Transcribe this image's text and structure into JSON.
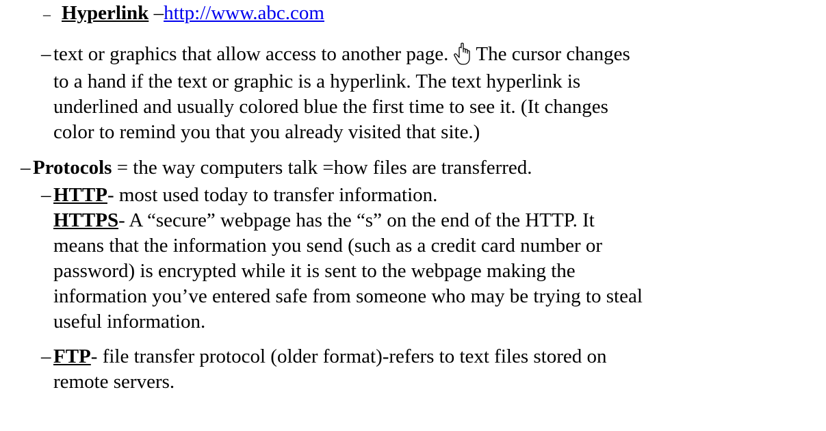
{
  "hyperlink": {
    "dash": "–",
    "term": "Hyperlink",
    "separator": " –",
    "url": "http://www.abc.com"
  },
  "hyperlink_desc": {
    "dash": "–",
    "line1a": "text or graphics that allow access to another page.",
    "cursor_icon": "hand-pointer-icon",
    "line1b": "The cursor changes",
    "line2": "to a hand if the text or graphic is a hyperlink. The text hyperlink is",
    "line3": "underlined and usually colored blue the first time to see it.  (It changes",
    "line4": "color to remind you that you already visited that site.)"
  },
  "protocols": {
    "dash": "–",
    "term": "Protocols",
    "text": " = the way computers talk =how files are transferred."
  },
  "http": {
    "dash": "–",
    "term": "HTTP",
    "text": "- most used today to transfer information."
  },
  "https": {
    "term": "HTTPS",
    "line1": "- A “secure” webpage has the “s” on the end of the HTTP.  It",
    "line2": "means that the information you send (such as a credit card number or",
    "line3": "password) is encrypted while it is sent to the webpage making the",
    "line4": "information you’ve entered safe from someone who may be trying to steal",
    "line5": "useful information."
  },
  "ftp": {
    "dash": "–",
    "term": "FTP",
    "line1": "- file transfer protocol (older format)-refers to text files stored on",
    "line2": "remote servers."
  }
}
